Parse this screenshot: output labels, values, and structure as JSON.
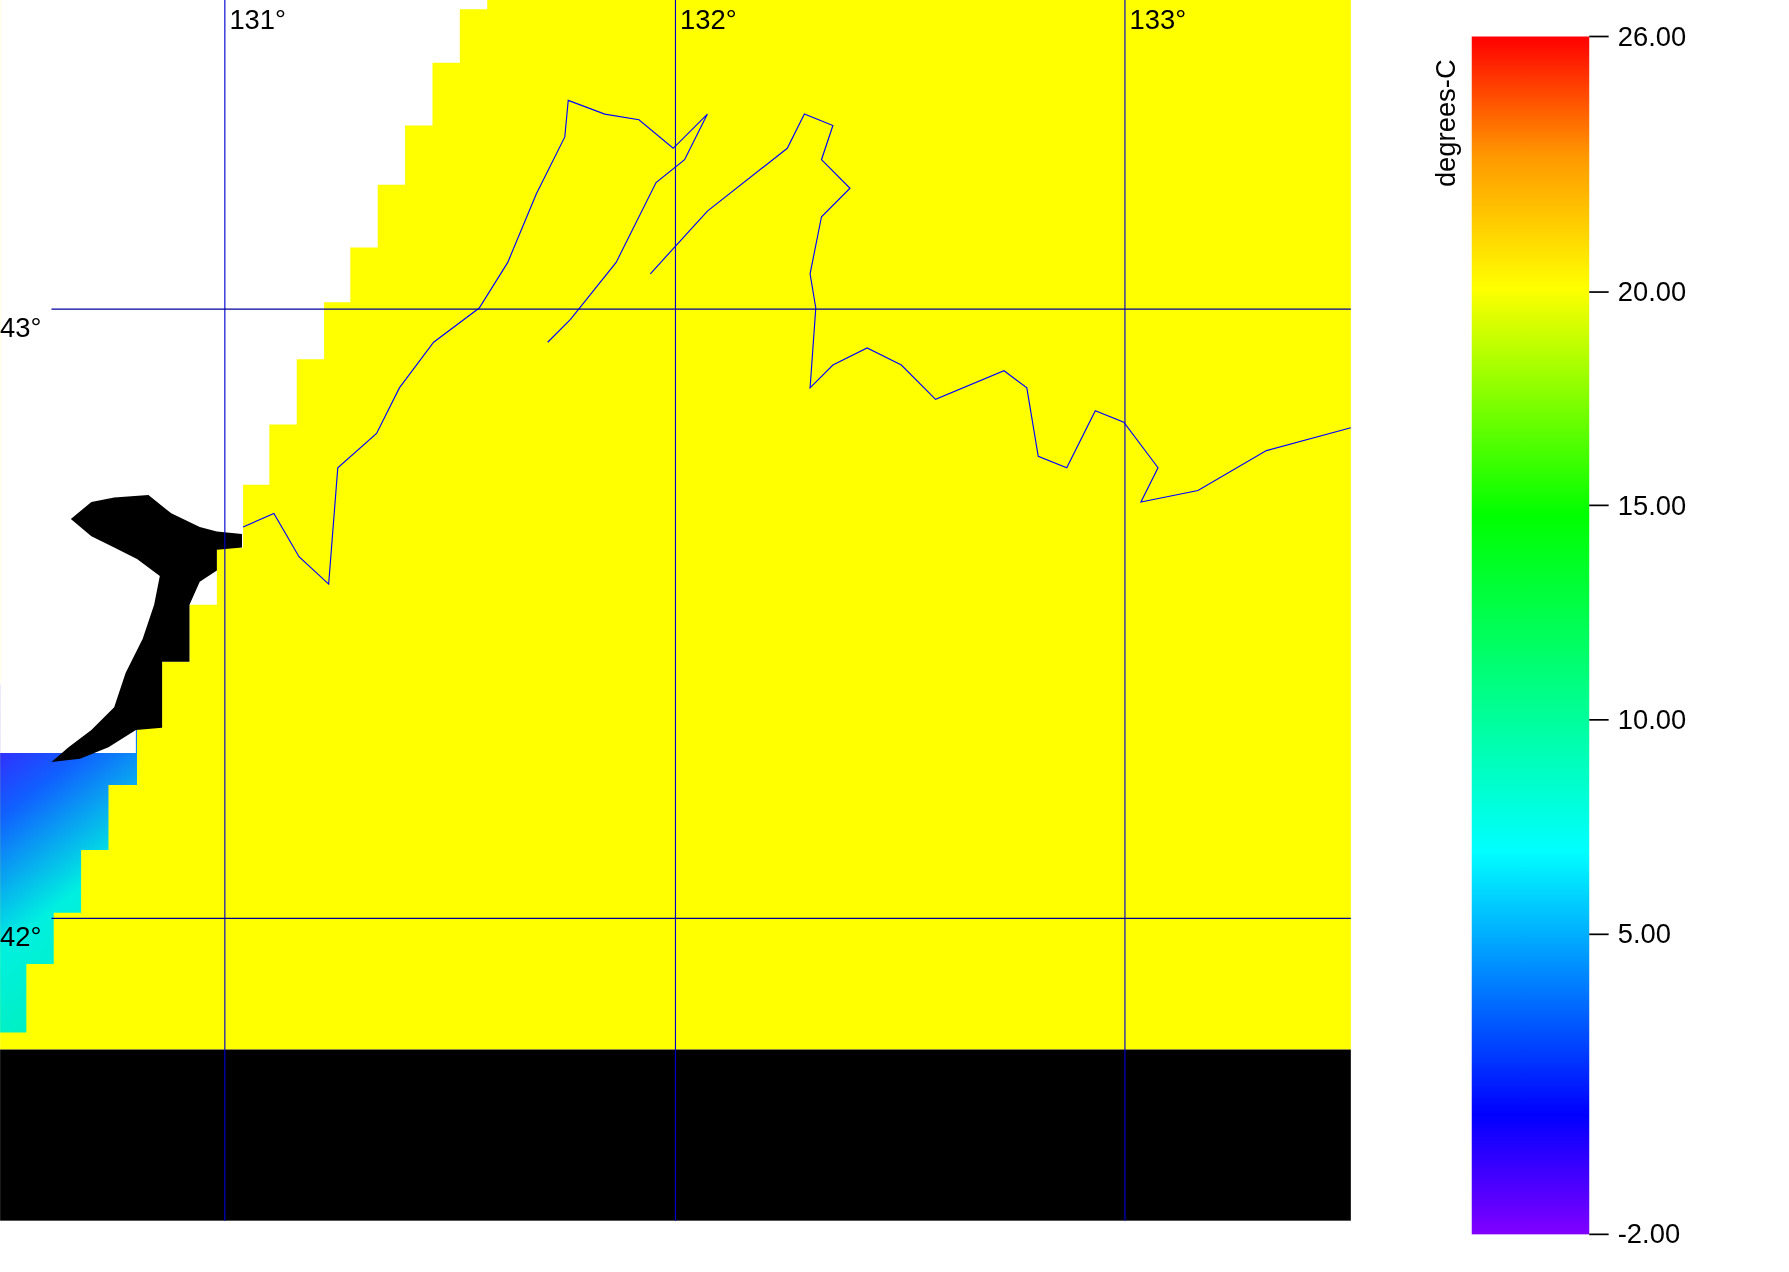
{
  "map": {
    "longitude_labels": [
      "131°",
      "132°",
      "133°"
    ],
    "latitude_labels": [
      "43°",
      "42°"
    ]
  },
  "colorbar": {
    "title": "degrees-C",
    "tick_labels": [
      "26.00",
      "20.00",
      "15.00",
      "10.00",
      "5.00",
      "-2.00"
    ]
  }
}
